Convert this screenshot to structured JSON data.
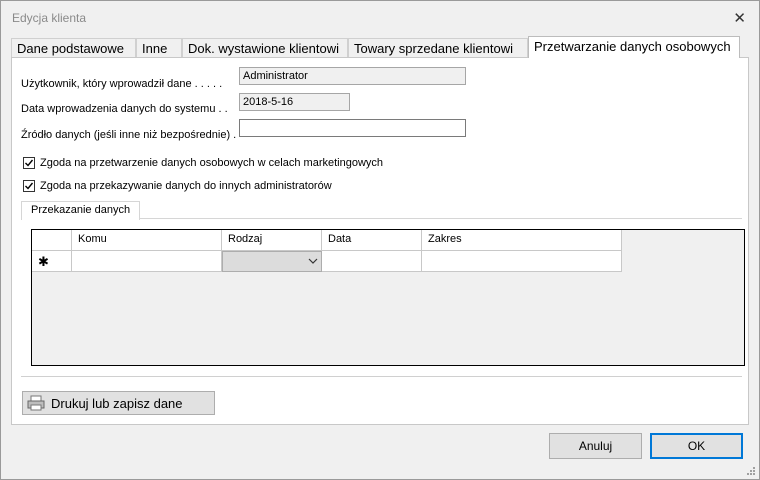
{
  "window": {
    "title": "Edycja klienta",
    "close_glyph": "✕"
  },
  "tabs": [
    {
      "label": "Dane podstawowe"
    },
    {
      "label": "Inne"
    },
    {
      "label": "Dok. wystawione klientowi"
    },
    {
      "label": "Towary sprzedane klientowi"
    },
    {
      "label": "Przetwarzanie danych osobowych"
    }
  ],
  "fields": {
    "user_label": "Użytkownik, który wprowadził dane . . . . .",
    "user_value": "Administrator",
    "date_label": "Data wprowadzenia danych do systemu . .",
    "date_value": "2018-5-16",
    "source_label": "Źródło danych (jeśli inne niż bezpośrednie) .",
    "source_value": ""
  },
  "consents": [
    {
      "label": "Zgoda na przetwarzenie danych osobowych w celach marketingowych",
      "checked": true
    },
    {
      "label": "Zgoda na przekazywanie danych do innych administratorów",
      "checked": true
    }
  ],
  "transfer": {
    "tab_label": "Przekazanie danych",
    "columns": [
      "Komu",
      "Rodzaj",
      "Data",
      "Zakres"
    ],
    "new_row_marker": "✱"
  },
  "print_button": {
    "label": "Drukuj lub zapisz dane",
    "icon": "printer-icon"
  },
  "buttons": {
    "cancel": "Anuluj",
    "ok": "OK"
  }
}
